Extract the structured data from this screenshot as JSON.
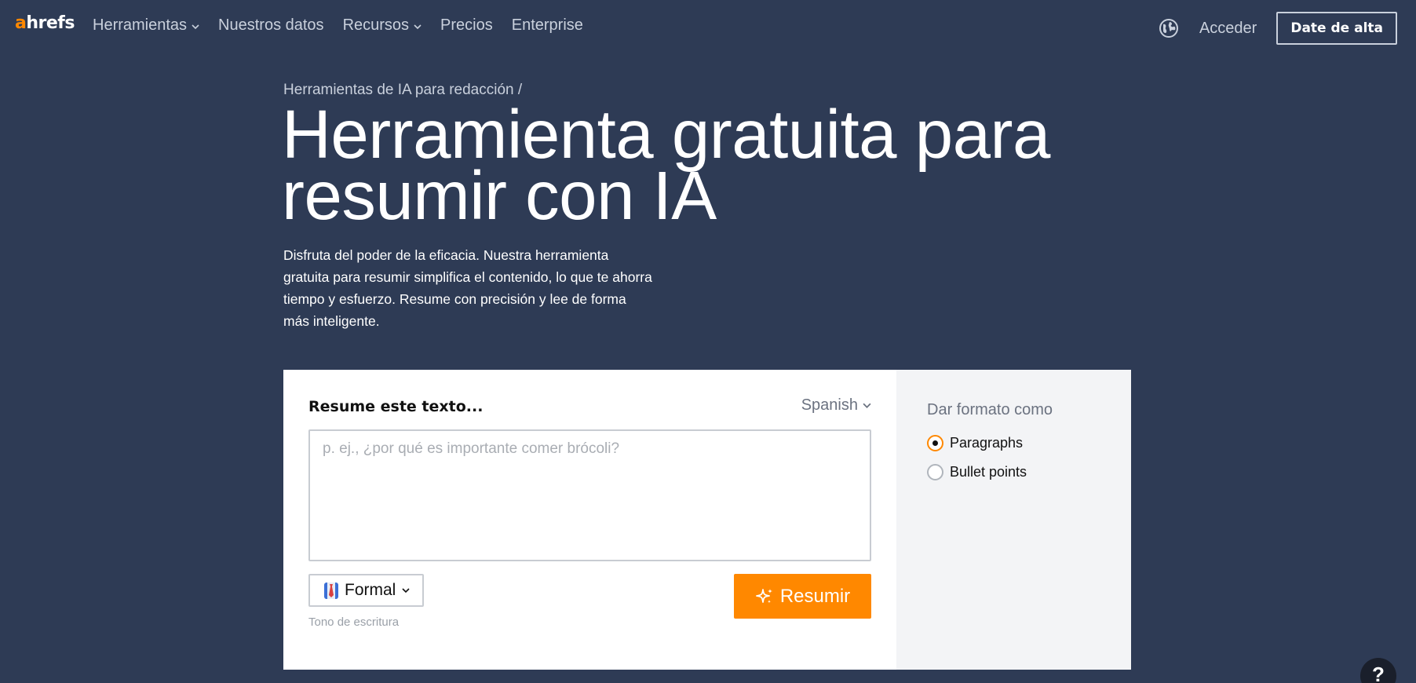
{
  "nav": {
    "logo_a": "a",
    "logo_rest": "hrefs",
    "items": [
      {
        "label": "Herramientas",
        "dropdown": true
      },
      {
        "label": "Nuestros datos",
        "dropdown": false
      },
      {
        "label": "Recursos",
        "dropdown": true
      },
      {
        "label": "Precios",
        "dropdown": false
      },
      {
        "label": "Enterprise",
        "dropdown": false
      }
    ],
    "language_icon": "globe-icon",
    "login_label": "Acceder",
    "signup_label": "Date de alta"
  },
  "hero": {
    "breadcrumb": "Herramientas de IA para redacción /",
    "title": "Herramienta gratuita para resumir con IA",
    "description": "Disfruta del poder de la eficacia. Nuestra herramienta gratuita para resumir simplifica el contenido, lo que te ahorra tiempo y esfuerzo. Resume con precisión y lee de forma más inteligente."
  },
  "tool": {
    "label": "Resume este texto...",
    "language": "Spanish",
    "input_placeholder": "p. ej., ¿por qué es importante comer brócoli?",
    "input_value": "",
    "tone": "Formal",
    "tone_icon": "necktie-emoji-icon",
    "tone_help": "Tono de escritura",
    "submit_label": "Resumir",
    "submit_icon": "sparkle-icon",
    "format": {
      "label": "Dar formato como",
      "options": [
        {
          "label": "Paragraphs",
          "checked": true
        },
        {
          "label": "Bullet points",
          "checked": false
        }
      ]
    }
  },
  "help": {
    "label": "?"
  },
  "colors": {
    "background": "#2e3b55",
    "accent": "#ff8800",
    "card": "#ffffff",
    "side_panel": "#f3f4f6"
  }
}
